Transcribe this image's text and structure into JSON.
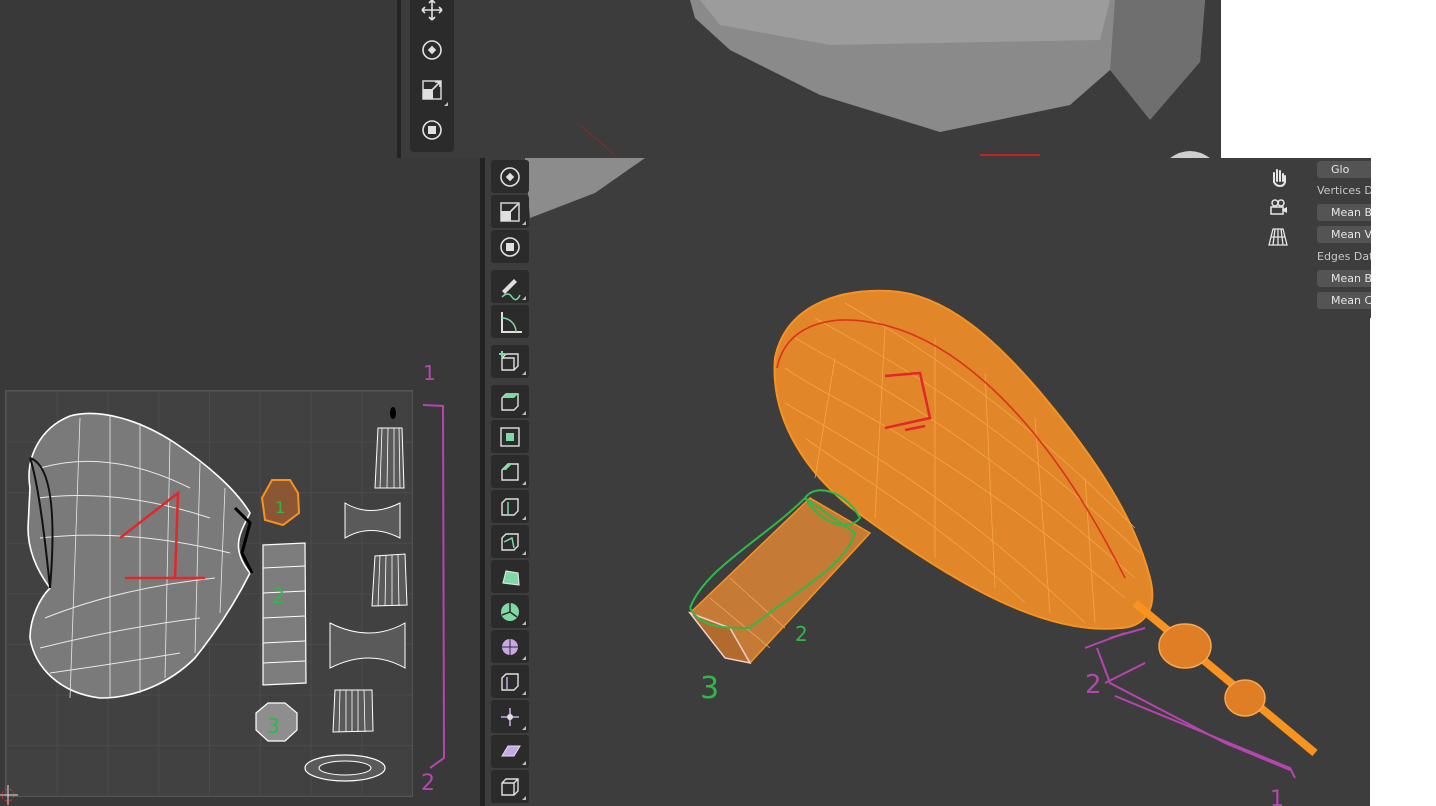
{
  "top_toolbar": {
    "tools": [
      "move-icon",
      "rotate-icon",
      "scale-icon",
      "transform-icon"
    ]
  },
  "main_toolbar": {
    "tools": [
      "rotate-icon",
      "scale-icon",
      "transform-icon",
      "annotate-icon",
      "measure-icon",
      "add-cube-icon",
      "extrude-region-icon",
      "inset-faces-icon",
      "bevel-icon",
      "loop-cut-icon",
      "knife-icon",
      "poly-build-icon",
      "spin-icon",
      "smooth-icon",
      "edge-slide-icon",
      "shrink-fatten-icon",
      "shear-icon",
      "rip-region-icon"
    ]
  },
  "navigation": {
    "buttons": [
      "hand-pan-icon",
      "camera-view-icon",
      "perspective-grid-icon"
    ]
  },
  "side_panel": {
    "global_button": "Glo",
    "vertices_label": "Vertices D",
    "vertices_buttons": [
      "Mean B",
      "Mean V"
    ],
    "edges_label": "Edges Dat",
    "edges_buttons": [
      "Mean B",
      "Mean C"
    ]
  },
  "annotations": {
    "uv_island_1": "1",
    "uv_island_2": "2",
    "uv_island_3": "3",
    "uv_bracket_top": "1",
    "uv_bracket_bottom": "2",
    "model_part_2": "2",
    "model_part_3": "3",
    "shaft_bracket_top": "2",
    "shaft_bracket_bottom": "1"
  },
  "colors": {
    "selection_orange": "#f7931e",
    "seam_red": "#e0282a",
    "annotation_green": "#2fb84a",
    "annotation_purple": "#b546b0",
    "tool_active_green": "#7fd9a4"
  }
}
